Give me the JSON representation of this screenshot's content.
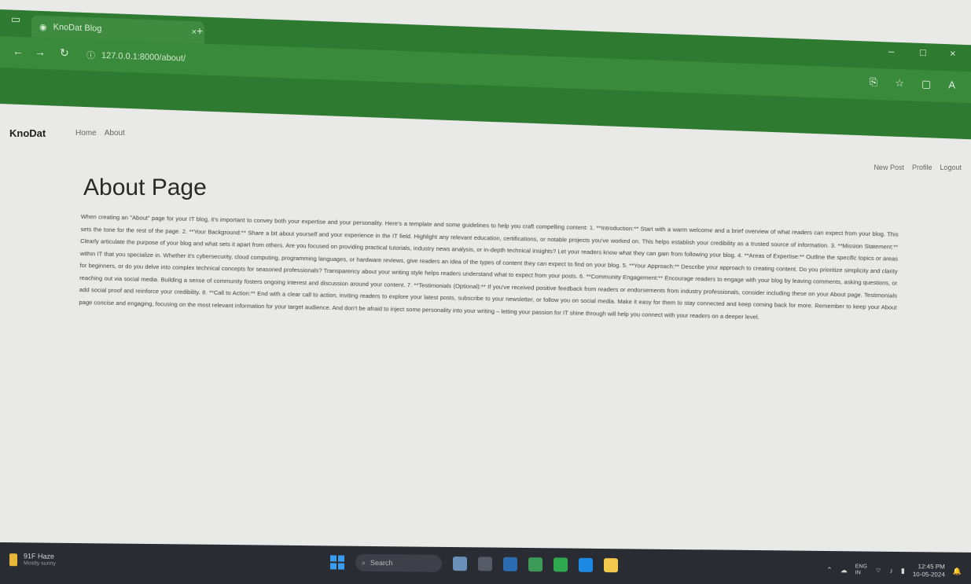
{
  "browser": {
    "tab_title": "KnoDat Blog",
    "tab_close": "×",
    "new_tab": "+",
    "address": "127.0.0.1:8000/about/",
    "nav": {
      "back": "←",
      "forward": "→",
      "reload": "↻"
    },
    "window_controls": {
      "minimize": "–",
      "maximize": "□",
      "close": "×"
    },
    "toolbar_icons": [
      "⎘",
      "☆",
      "▢",
      "A"
    ]
  },
  "site": {
    "brand": "KnoDat",
    "nav": [
      "Home",
      "About"
    ],
    "user_links": [
      "New Post",
      "Profile",
      "Logout"
    ]
  },
  "main": {
    "title": "About Page",
    "body": "When creating an \"About\" page for your IT blog, it's important to convey both your expertise and your personality. Here's a template and some guidelines to help you craft compelling content: 1. **Introduction:** Start with a warm welcome and a brief overview of what readers can expect from your blog. This sets the tone for the rest of the page. 2. **Your Background:** Share a bit about yourself and your experience in the IT field. Highlight any relevant education, certifications, or notable projects you've worked on. This helps establish your credibility as a trusted source of information. 3. **Mission Statement:** Clearly articulate the purpose of your blog and what sets it apart from others. Are you focused on providing practical tutorials, industry news analysis, or in-depth technical insights? Let your readers know what they can gain from following your blog. 4. **Areas of Expertise:** Outline the specific topics or areas within IT that you specialize in. Whether it's cybersecurity, cloud computing, programming languages, or hardware reviews, give readers an idea of the types of content they can expect to find on your blog. 5. **Your Approach:** Describe your approach to creating content. Do you prioritize simplicity and clarity for beginners, or do you delve into complex technical concepts for seasoned professionals? Transparency about your writing style helps readers understand what to expect from your posts. 6. **Community Engagement:** Encourage readers to engage with your blog by leaving comments, asking questions, or reaching out via social media. Building a sense of community fosters ongoing interest and discussion around your content. 7. **Testimonials (Optional):** If you've received positive feedback from readers or endorsements from industry professionals, consider including these on your About page. Testimonials add social proof and reinforce your credibility. 8. **Call to Action:** End with a clear call to action, inviting readers to explore your latest posts, subscribe to your newsletter, or follow you on social media. Make it easy for them to stay connected and keep coming back for more. Remember to keep your About page concise and engaging, focusing on the most relevant information for your target audience. And don't be afraid to inject some personality into your writing – letting your passion for IT shine through will help you connect with your readers on a deeper level."
  },
  "taskbar": {
    "weather_temp": "91F",
    "weather_text": "Haze",
    "weather_sub": "Mostly sunny",
    "search_label": "Search",
    "lang": "ENG",
    "lang_sub": "IN",
    "time": "12:45 PM",
    "date": "10-05-2024",
    "colors": {
      "bar": "#2a2c33",
      "browser": "#2e7a31"
    }
  }
}
